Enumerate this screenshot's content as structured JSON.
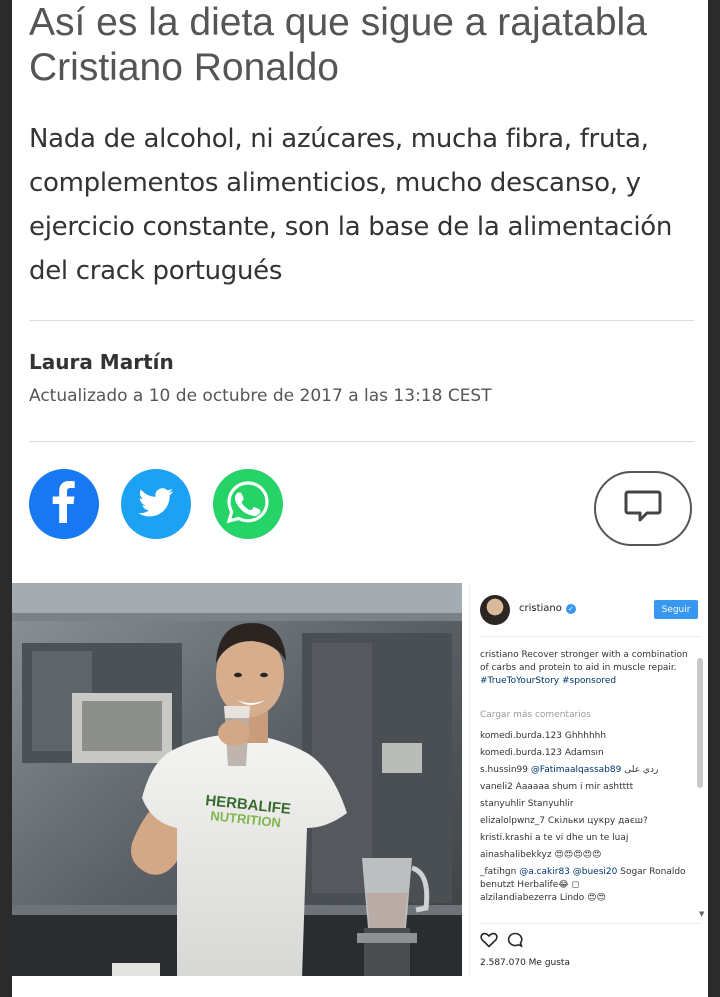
{
  "article": {
    "headline": "Así es la dieta que sigue a rajatabla Cristiano Ronaldo",
    "subtitle": "Nada de alcohol, ni azúcares, mucha fibra, fruta, complementos alimenticios, mucho descanso, y ejercicio constante, son la base de la alimentación del crack portugués",
    "author": "Laura Martín",
    "updated": "Actualizado a 10 de octubre de 2017 a las 13:18 CEST"
  },
  "share": {
    "facebook_icon": "facebook-icon",
    "twitter_icon": "twitter-icon",
    "whatsapp_icon": "whatsapp-icon",
    "comment_icon": "comment-bubble-icon"
  },
  "figure": {
    "shirt_line1": "HERBALIFE",
    "shirt_line2": "NUTRITION"
  },
  "instagram": {
    "username": "cristiano",
    "verified_mark": "✓",
    "follow_label": "Seguir",
    "caption_user": "cristiano",
    "caption_text": " Recover stronger with a combination of carbs and protein to aid in muscle repair. ",
    "caption_tags": "#TrueToYourStory #sponsored",
    "load_more": "Cargar más comentarios",
    "comments": [
      {
        "user": "komedi.burda.123",
        "text": " Ghhhhhh"
      },
      {
        "user": "komedi.burda.123",
        "text": " Adamsın"
      },
      {
        "user": "s.hussin99",
        "mention": " @Fatimaalqassab89",
        "text": "ردي على"
      },
      {
        "user": "vaneli2",
        "text": " Aaaaaa shum i mir ashtttt"
      },
      {
        "user": "stanyuhlir",
        "text": " Stanyuhlir"
      },
      {
        "user": "elizalolpwnz_7",
        "text": " Скільки цукру даєш?"
      },
      {
        "user": "kristi.krashi",
        "text": " a te vi dhe un te luaj"
      },
      {
        "user": "ainashalibekkyz",
        "text": " 😍😍😍😍😍"
      },
      {
        "user": "_fatihgn",
        "mention": " @a.cakir83 @buesi20",
        "text": " Sogar Ronaldo benutzt Herbalife😂 ◻"
      },
      {
        "user": "alzilandiabezerra",
        "text": " Lindo 😍😍"
      }
    ],
    "likes": "2.587.070 Me gusta",
    "heart_icon": "heart-icon",
    "comment_icon": "comment-icon"
  }
}
